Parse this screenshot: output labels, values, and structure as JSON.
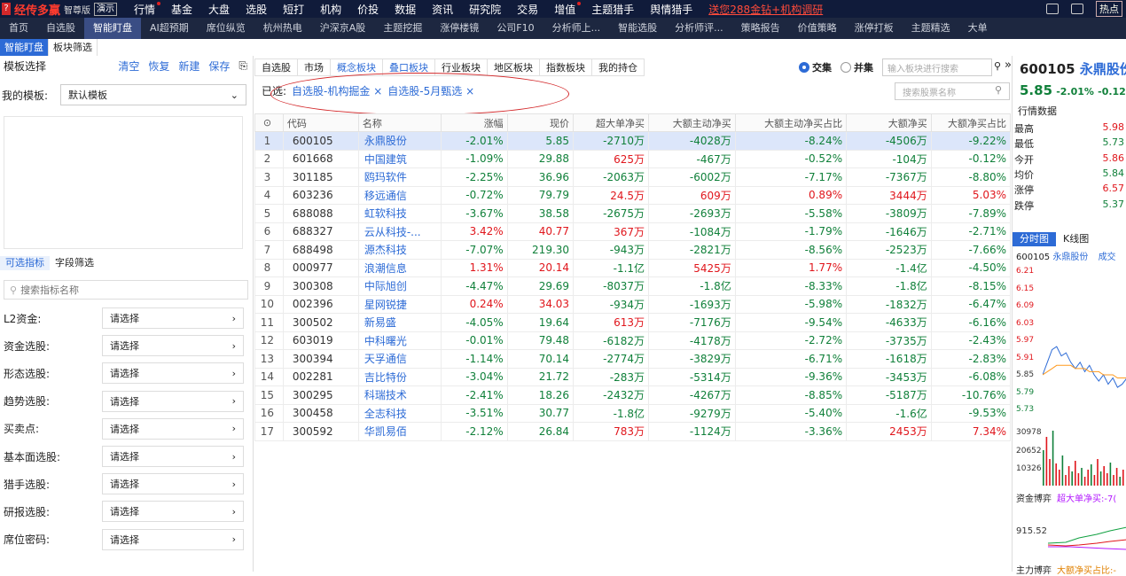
{
  "app": {
    "brand": "经传多赢",
    "edition": "智尊版",
    "demo": "演示",
    "top_menu": [
      "行情",
      "基金",
      "大盘",
      "选股",
      "短打",
      "机构",
      "价投",
      "数据",
      "资讯",
      "研究院",
      "交易",
      "增值",
      "主题猎手",
      "舆情猎手"
    ],
    "promo": "送您288金钻+机构调研",
    "hot": "热点"
  },
  "nav": [
    "首页",
    "自选股",
    "智能盯盘",
    "AI超预期",
    "席位纵览",
    "杭州热电",
    "沪深京A股",
    "主题挖掘",
    "涨停楼镜",
    "公司F10",
    "分析师上...",
    "智能选股",
    "分析师评...",
    "策略报告",
    "价值策略",
    "涨停打板",
    "主题精选",
    "大单"
  ],
  "nav_active": "智能盯盘",
  "subtabs": [
    "智能盯盘",
    "板块筛选"
  ],
  "left": {
    "title": "模板选择",
    "links": [
      "清空",
      "恢复",
      "新建",
      "保存"
    ],
    "my_template_label": "我的模板:",
    "my_template_value": "默认模板",
    "ind_tabs": [
      "可选指标",
      "字段筛选"
    ],
    "search_placeholder": "搜索指标名称",
    "rows": [
      {
        "label": "L2资金:",
        "value": "请选择"
      },
      {
        "label": "资金选股:",
        "value": "请选择"
      },
      {
        "label": "形态选股:",
        "value": "请选择"
      },
      {
        "label": "趋势选股:",
        "value": "请选择"
      },
      {
        "label": "买卖点:",
        "value": "请选择"
      },
      {
        "label": "基本面选股:",
        "value": "请选择"
      },
      {
        "label": "猎手选股:",
        "value": "请选择"
      },
      {
        "label": "研报选股:",
        "value": "请选择"
      },
      {
        "label": "席位密码:",
        "value": "请选择"
      }
    ]
  },
  "block_tabs": [
    "自选股",
    "市场",
    "概念板块",
    "叠口板块",
    "行业板块",
    "地区板块",
    "指数板块",
    "我的持仓"
  ],
  "radio": {
    "intersect": "交集",
    "union": "并集"
  },
  "block_search_placeholder": "输入板块进行搜索",
  "selected_label": "已选:",
  "selected_tags": [
    "自选股-机构掘金",
    "自选股-5月甄选"
  ],
  "stock_search_placeholder": "搜索股票名称",
  "table": {
    "headers": [
      "",
      "代码",
      "名称",
      "涨幅",
      "现价",
      "超大单净买",
      "大额主动净买",
      "大额主动净买占比",
      "大额净买",
      "大额净买占比"
    ],
    "rows": [
      {
        "n": "1",
        "code": "600105",
        "name": "永鼎股份",
        "chg": "-2.01%",
        "price": "5.85",
        "sb": "-2710万",
        "ab": "-4028万",
        "ap": "-8.24%",
        "bb": "-4506万",
        "bp": "-9.22%"
      },
      {
        "n": "2",
        "code": "601668",
        "name": "中国建筑",
        "chg": "-1.09%",
        "price": "29.88",
        "sb": "625万",
        "ab": "-467万",
        "ap": "-0.52%",
        "bb": "-104万",
        "bp": "-0.12%"
      },
      {
        "n": "3",
        "code": "301185",
        "name": "鸥玛软件",
        "chg": "-2.25%",
        "price": "36.96",
        "sb": "-2063万",
        "ab": "-6002万",
        "ap": "-7.17%",
        "bb": "-7367万",
        "bp": "-8.80%"
      },
      {
        "n": "4",
        "code": "603236",
        "name": "移远通信",
        "chg": "-0.72%",
        "price": "79.79",
        "sb": "24.5万",
        "ab": "609万",
        "ap": "0.89%",
        "bb": "3444万",
        "bp": "5.03%"
      },
      {
        "n": "5",
        "code": "688088",
        "name": "虹软科技",
        "chg": "-3.67%",
        "price": "38.58",
        "sb": "-2675万",
        "ab": "-2693万",
        "ap": "-5.58%",
        "bb": "-3809万",
        "bp": "-7.89%"
      },
      {
        "n": "6",
        "code": "688327",
        "name": "云从科技-...",
        "chg": "3.42%",
        "price": "40.77",
        "sb": "367万",
        "ab": "-1084万",
        "ap": "-1.79%",
        "bb": "-1646万",
        "bp": "-2.71%"
      },
      {
        "n": "7",
        "code": "688498",
        "name": "源杰科技",
        "chg": "-7.07%",
        "price": "219.30",
        "sb": "-943万",
        "ab": "-2821万",
        "ap": "-8.56%",
        "bb": "-2523万",
        "bp": "-7.66%"
      },
      {
        "n": "8",
        "code": "000977",
        "name": "浪潮信息",
        "chg": "1.31%",
        "price": "20.14",
        "sb": "-1.1亿",
        "ab": "5425万",
        "ap": "1.77%",
        "bb": "-1.4亿",
        "bp": "-4.50%"
      },
      {
        "n": "9",
        "code": "300308",
        "name": "中际旭创",
        "chg": "-4.47%",
        "price": "29.69",
        "sb": "-8037万",
        "ab": "-1.8亿",
        "ap": "-8.33%",
        "bb": "-1.8亿",
        "bp": "-8.15%"
      },
      {
        "n": "10",
        "code": "002396",
        "name": "星网锐捷",
        "chg": "0.24%",
        "price": "34.03",
        "sb": "-934万",
        "ab": "-1693万",
        "ap": "-5.98%",
        "bb": "-1832万",
        "bp": "-6.47%"
      },
      {
        "n": "11",
        "code": "300502",
        "name": "新易盛",
        "chg": "-4.05%",
        "price": "19.64",
        "sb": "613万",
        "ab": "-7176万",
        "ap": "-9.54%",
        "bb": "-4633万",
        "bp": "-6.16%"
      },
      {
        "n": "12",
        "code": "603019",
        "name": "中科曙光",
        "chg": "-0.01%",
        "price": "79.48",
        "sb": "-6182万",
        "ab": "-4178万",
        "ap": "-2.72%",
        "bb": "-3735万",
        "bp": "-2.43%"
      },
      {
        "n": "13",
        "code": "300394",
        "name": "天孚通信",
        "chg": "-1.14%",
        "price": "70.14",
        "sb": "-2774万",
        "ab": "-3829万",
        "ap": "-6.71%",
        "bb": "-1618万",
        "bp": "-2.83%"
      },
      {
        "n": "14",
        "code": "002281",
        "name": "吉比特份",
        "chg": "-3.04%",
        "price": "21.72",
        "sb": "-283万",
        "ab": "-5314万",
        "ap": "-9.36%",
        "bb": "-3453万",
        "bp": "-6.08%"
      },
      {
        "n": "15",
        "code": "300295",
        "name": "科瑞技术",
        "chg": "-2.41%",
        "price": "18.26",
        "sb": "-2432万",
        "ab": "-4267万",
        "ap": "-8.85%",
        "bb": "-5187万",
        "bp": "-10.76%"
      },
      {
        "n": "16",
        "code": "300458",
        "name": "全志科技",
        "chg": "-3.51%",
        "price": "30.77",
        "sb": "-1.8亿",
        "ab": "-9279万",
        "ap": "-5.40%",
        "bb": "-1.6亿",
        "bp": "-9.53%"
      },
      {
        "n": "17",
        "code": "300592",
        "name": "华凯易佰",
        "chg": "-2.12%",
        "price": "26.84",
        "sb": "783万",
        "ab": "-1124万",
        "ap": "-3.36%",
        "bb": "2453万",
        "bp": "7.34%"
      }
    ]
  },
  "right": {
    "code": "600105",
    "name": "永鼎股份",
    "price": "5.85",
    "change_pct": "-2.01%",
    "change": "-0.12",
    "section": "行情数据",
    "quotes": [
      {
        "k": "最高",
        "v": "5.98",
        "dir": "up"
      },
      {
        "k": "最低",
        "v": "5.73",
        "dir": "dn"
      },
      {
        "k": "今开",
        "v": "5.86",
        "dir": "up"
      },
      {
        "k": "均价",
        "v": "5.84",
        "dir": "dn"
      },
      {
        "k": "涨停",
        "v": "6.57",
        "dir": "up"
      },
      {
        "k": "跌停",
        "v": "5.37",
        "dir": "dn"
      }
    ],
    "chart_tabs": [
      "分时图",
      "K线图"
    ],
    "chart_caption": "成交",
    "price_axis": [
      "6.21",
      "6.15",
      "6.09",
      "6.03",
      "5.97",
      "5.91",
      "5.85",
      "5.79",
      "5.73"
    ],
    "vol_axis": [
      "30978",
      "20652",
      "10326"
    ],
    "fund_label": "资金博弈",
    "fund_sub": "超大单净买:-7(",
    "fund_value": "915.52",
    "main_label": "主力博弈",
    "main_sub": "大额净买占比:-"
  },
  "chart_data": {
    "type": "line",
    "series": [
      {
        "values": [
          5.86,
          5.9,
          5.94,
          5.95,
          5.92,
          5.93,
          5.9,
          5.88,
          5.9,
          5.87,
          5.89,
          5.86,
          5.84,
          5.86,
          5.83,
          5.85,
          5.82,
          5.83,
          5.85
        ]
      },
      {
        "values": [
          5.86,
          5.87,
          5.88,
          5.89,
          5.89,
          5.89,
          5.89,
          5.88,
          5.88,
          5.88,
          5.87,
          5.87,
          5.87,
          5.86,
          5.86,
          5.86,
          5.85,
          5.85,
          5.85
        ]
      }
    ],
    "ylim": [
      5.73,
      6.21
    ]
  }
}
